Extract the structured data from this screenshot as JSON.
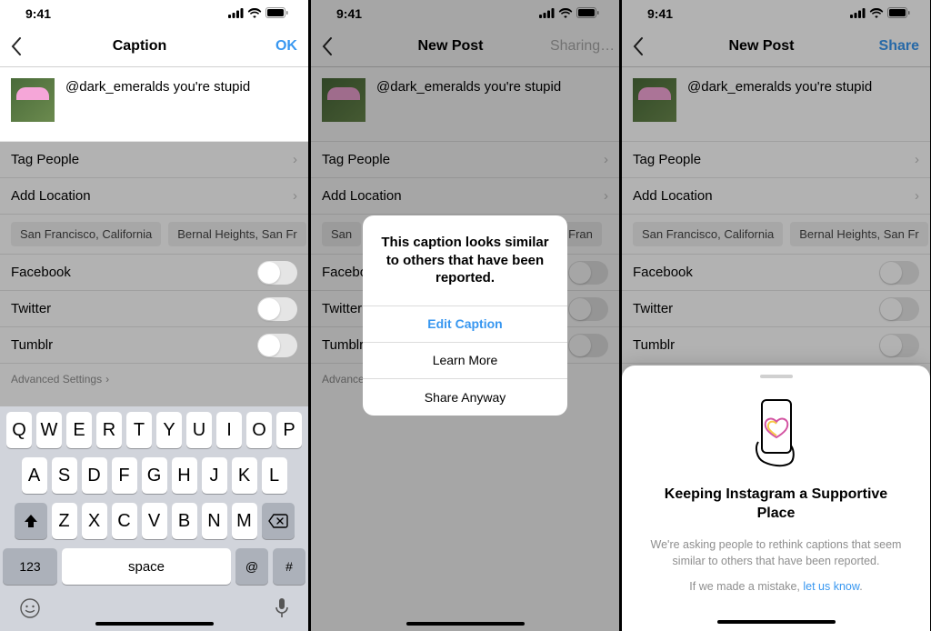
{
  "status": {
    "time": "9:41"
  },
  "screen1": {
    "title": "Caption",
    "action": "OK",
    "caption": "@dark_emeralds you're stupid",
    "tag_people": "Tag People",
    "add_location": "Add Location",
    "chips": [
      "San Francisco, California",
      "Bernal Heights, San Fr"
    ],
    "share": {
      "facebook": "Facebook",
      "twitter": "Twitter",
      "tumblr": "Tumblr"
    },
    "advanced": "Advanced Settings",
    "keyboard": {
      "row1": [
        "Q",
        "W",
        "E",
        "R",
        "T",
        "Y",
        "U",
        "I",
        "O",
        "P"
      ],
      "row2": [
        "A",
        "S",
        "D",
        "F",
        "G",
        "H",
        "J",
        "K",
        "L"
      ],
      "row3": [
        "Z",
        "X",
        "C",
        "V",
        "B",
        "N",
        "M"
      ],
      "num": "123",
      "space": "space",
      "at": "@",
      "hash": "#"
    }
  },
  "screen2": {
    "title": "New Post",
    "action": "Sharing…",
    "caption": "@dark_emeralds you're stupid",
    "tag_people": "Tag People",
    "add_location": "Add Location",
    "chips": [
      "San",
      "Fran"
    ],
    "share": {
      "facebook": "Facebook",
      "twitter": "Twitter",
      "tumblr": "Tumblr"
    },
    "advanced": "Advanced Settings",
    "popup": {
      "message": "This caption looks similar to others that have been reported.",
      "edit": "Edit Caption",
      "learn": "Learn More",
      "share_anyway": "Share Anyway"
    }
  },
  "screen3": {
    "title": "New Post",
    "action": "Share",
    "caption": "@dark_emeralds you're stupid",
    "tag_people": "Tag People",
    "add_location": "Add Location",
    "chips": [
      "San Francisco, California",
      "Bernal Heights, San Fr"
    ],
    "share": {
      "facebook": "Facebook",
      "twitter": "Twitter",
      "tumblr": "Tumblr"
    },
    "sheet": {
      "title": "Keeping Instagram a Supportive Place",
      "body": "We're asking people to rethink captions that seem similar to others that have been reported.",
      "mistake_prefix": "If we made a mistake, ",
      "mistake_link": "let us know",
      "mistake_suffix": "."
    }
  }
}
